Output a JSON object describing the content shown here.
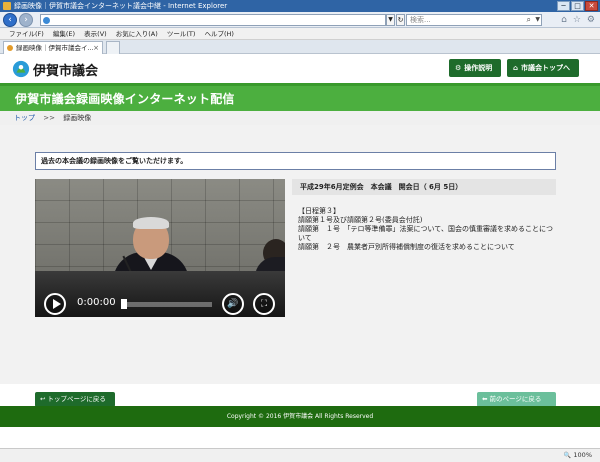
{
  "window": {
    "title": "録画映像｜伊賀市議会インターネット議会中継 - Internet Explorer",
    "minimize": "─",
    "maximize": "□",
    "close": "✕"
  },
  "browser": {
    "url": "",
    "search_placeholder": "検索...",
    "menu": [
      "ファイル(F)",
      "編集(E)",
      "表示(V)",
      "お気に入り(A)",
      "ツール(T)",
      "ヘルプ(H)"
    ],
    "tab_label": "録画映像｜伊賀市議会イ...",
    "zoom": "100%"
  },
  "header": {
    "logo_text": "伊賀市議会",
    "help_button": "操作説明",
    "top_button": "市議会トップへ"
  },
  "banner": {
    "title": "伊賀市議会録画映像インターネット配信"
  },
  "breadcrumb": {
    "home": "トップ",
    "separator": ">>",
    "current": "録画映像"
  },
  "main": {
    "notice": "過去の本会議の録画映像をご覧いただけます。",
    "meeting_header": "平成29年6月定例会　本会議　開会日（ 6月 5日）",
    "agenda": [
      "【日程第３】",
      "請願第１号及び請願第２号(委員会付託)",
      "請願第　１号　「テロ等準備罪」法案について、国会の慎重審議を求めることについて",
      "請願第　２号　農業者戸別所得補償制度の復活を求めることについて"
    ]
  },
  "player": {
    "time": "0:00:00",
    "progress_fraction": 0
  },
  "buttons": {
    "back_to_top": "トップページに戻る",
    "prev_page": "前のページに戻る"
  },
  "footer": {
    "copyright": "Copyright © 2016 伊賀市議会 All Rights Reserved"
  },
  "colors": {
    "brand_green": "#4caf3f",
    "dark_green": "#1e6b2b",
    "footer_green": "#1e6b0f",
    "prev_button": "#6bbf9b"
  }
}
